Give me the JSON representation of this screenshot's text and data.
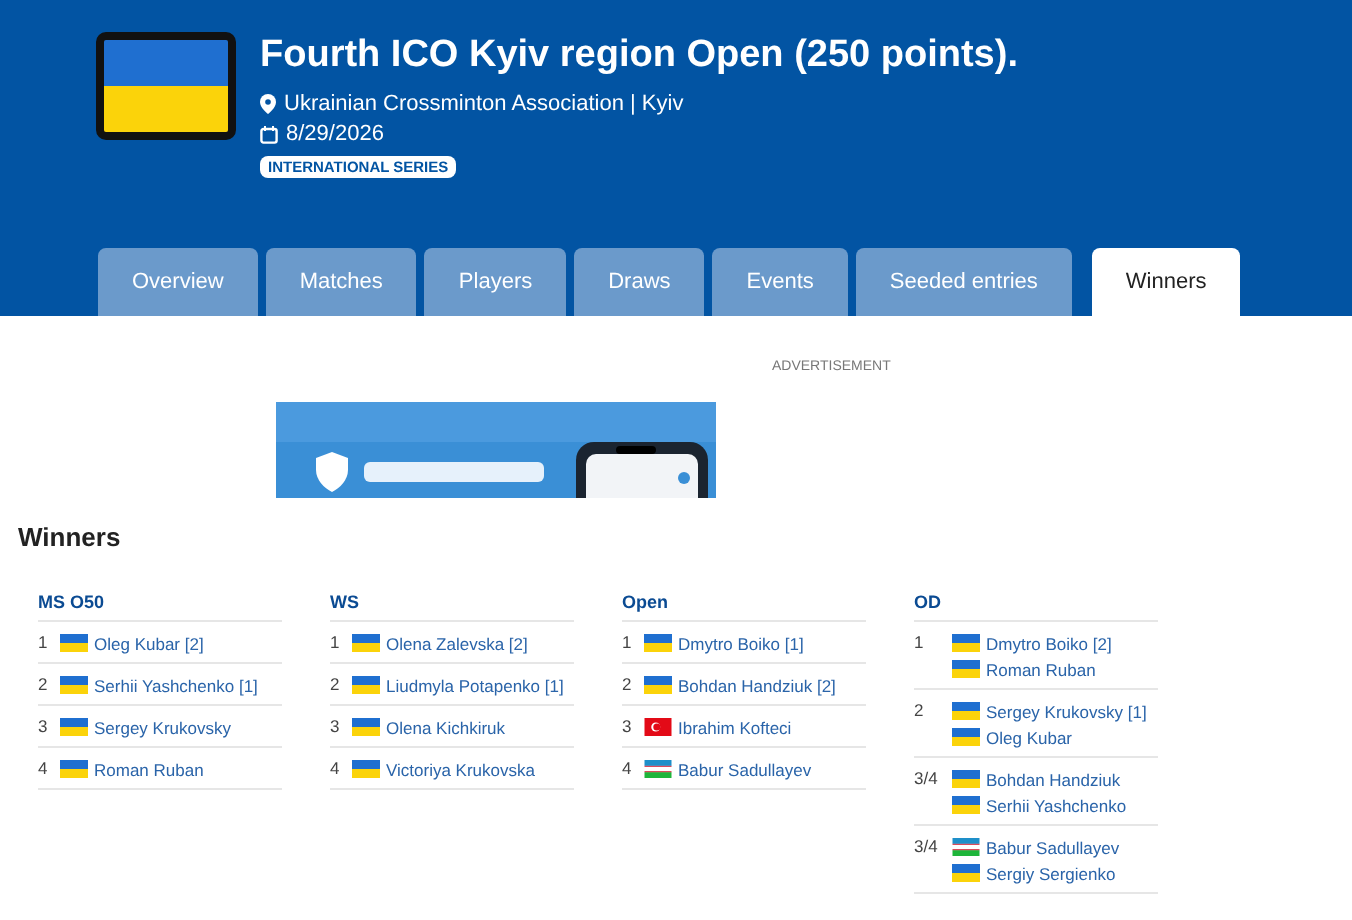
{
  "event": {
    "title": "Fourth ICO Kyiv region Open (250 points).",
    "location": "Ukrainian Crossminton Association | Kyiv",
    "date": "8/29/2026",
    "badge": "INTERNATIONAL SERIES",
    "flag": {
      "kind": "ua"
    }
  },
  "tabs": [
    {
      "label": "Overview",
      "selected": false
    },
    {
      "label": "Matches",
      "selected": false
    },
    {
      "label": "Players",
      "selected": false
    },
    {
      "label": "Draws",
      "selected": false
    },
    {
      "label": "Events",
      "selected": false
    },
    {
      "label": "Seeded entries",
      "selected": false
    },
    {
      "label": "Winners",
      "selected": true
    }
  ],
  "advertisement": {
    "label": "ADVERTISEMENT",
    "kind": "picture"
  },
  "section_title": "Winners",
  "events": [
    {
      "name": "MS O50",
      "rows": [
        {
          "place": "1",
          "players": [
            {
              "name": "Oleg Kubar [2]",
              "kind": "ua"
            }
          ]
        },
        {
          "place": "2",
          "players": [
            {
              "name": "Serhii Yashchenko [1]",
              "kind": "ua"
            }
          ]
        },
        {
          "place": "3",
          "players": [
            {
              "name": "Sergey Krukovsky",
              "kind": "ua"
            }
          ]
        },
        {
          "place": "4",
          "players": [
            {
              "name": "Roman Ruban",
              "kind": "ua"
            }
          ]
        }
      ]
    },
    {
      "name": "WS",
      "rows": [
        {
          "place": "1",
          "players": [
            {
              "name": "Olena Zalevska [2]",
              "kind": "ua"
            }
          ]
        },
        {
          "place": "2",
          "players": [
            {
              "name": "Liudmyla Potapenko [1]",
              "kind": "ua"
            }
          ]
        },
        {
          "place": "3",
          "players": [
            {
              "name": "Olena Kichkiruk",
              "kind": "ua"
            }
          ]
        },
        {
          "place": "4",
          "players": [
            {
              "name": "Victoriya Krukovska",
              "kind": "ua"
            }
          ]
        }
      ]
    },
    {
      "name": "Open",
      "rows": [
        {
          "place": "1",
          "players": [
            {
              "name": "Dmytro Boiko [1]",
              "kind": "ua"
            }
          ]
        },
        {
          "place": "2",
          "players": [
            {
              "name": "Bohdan Handziuk [2]",
              "kind": "ua"
            }
          ]
        },
        {
          "place": "3",
          "players": [
            {
              "name": "Ibrahim Kofteci",
              "kind": "tr"
            }
          ]
        },
        {
          "place": "4",
          "players": [
            {
              "name": "Babur Sadullayev",
              "kind": "uz"
            }
          ]
        }
      ]
    },
    {
      "name": "OD",
      "rows": [
        {
          "place": "1",
          "players": [
            {
              "name": "Dmytro Boiko [2]",
              "kind": "ua"
            },
            {
              "name": "Roman Ruban",
              "kind": "ua"
            }
          ]
        },
        {
          "place": "2",
          "players": [
            {
              "name": "Sergey Krukovsky [1]",
              "kind": "ua"
            },
            {
              "name": "Oleg Kubar",
              "kind": "ua"
            }
          ]
        },
        {
          "place": "3/4",
          "players": [
            {
              "name": "Bohdan Handziuk",
              "kind": "ua"
            },
            {
              "name": "Serhii Yashchenko",
              "kind": "ua"
            }
          ]
        },
        {
          "place": "3/4",
          "players": [
            {
              "name": "Babur Sadullayev",
              "kind": "uz"
            },
            {
              "name": "Sergiy Sergienko",
              "kind": "ua"
            }
          ]
        }
      ]
    }
  ]
}
